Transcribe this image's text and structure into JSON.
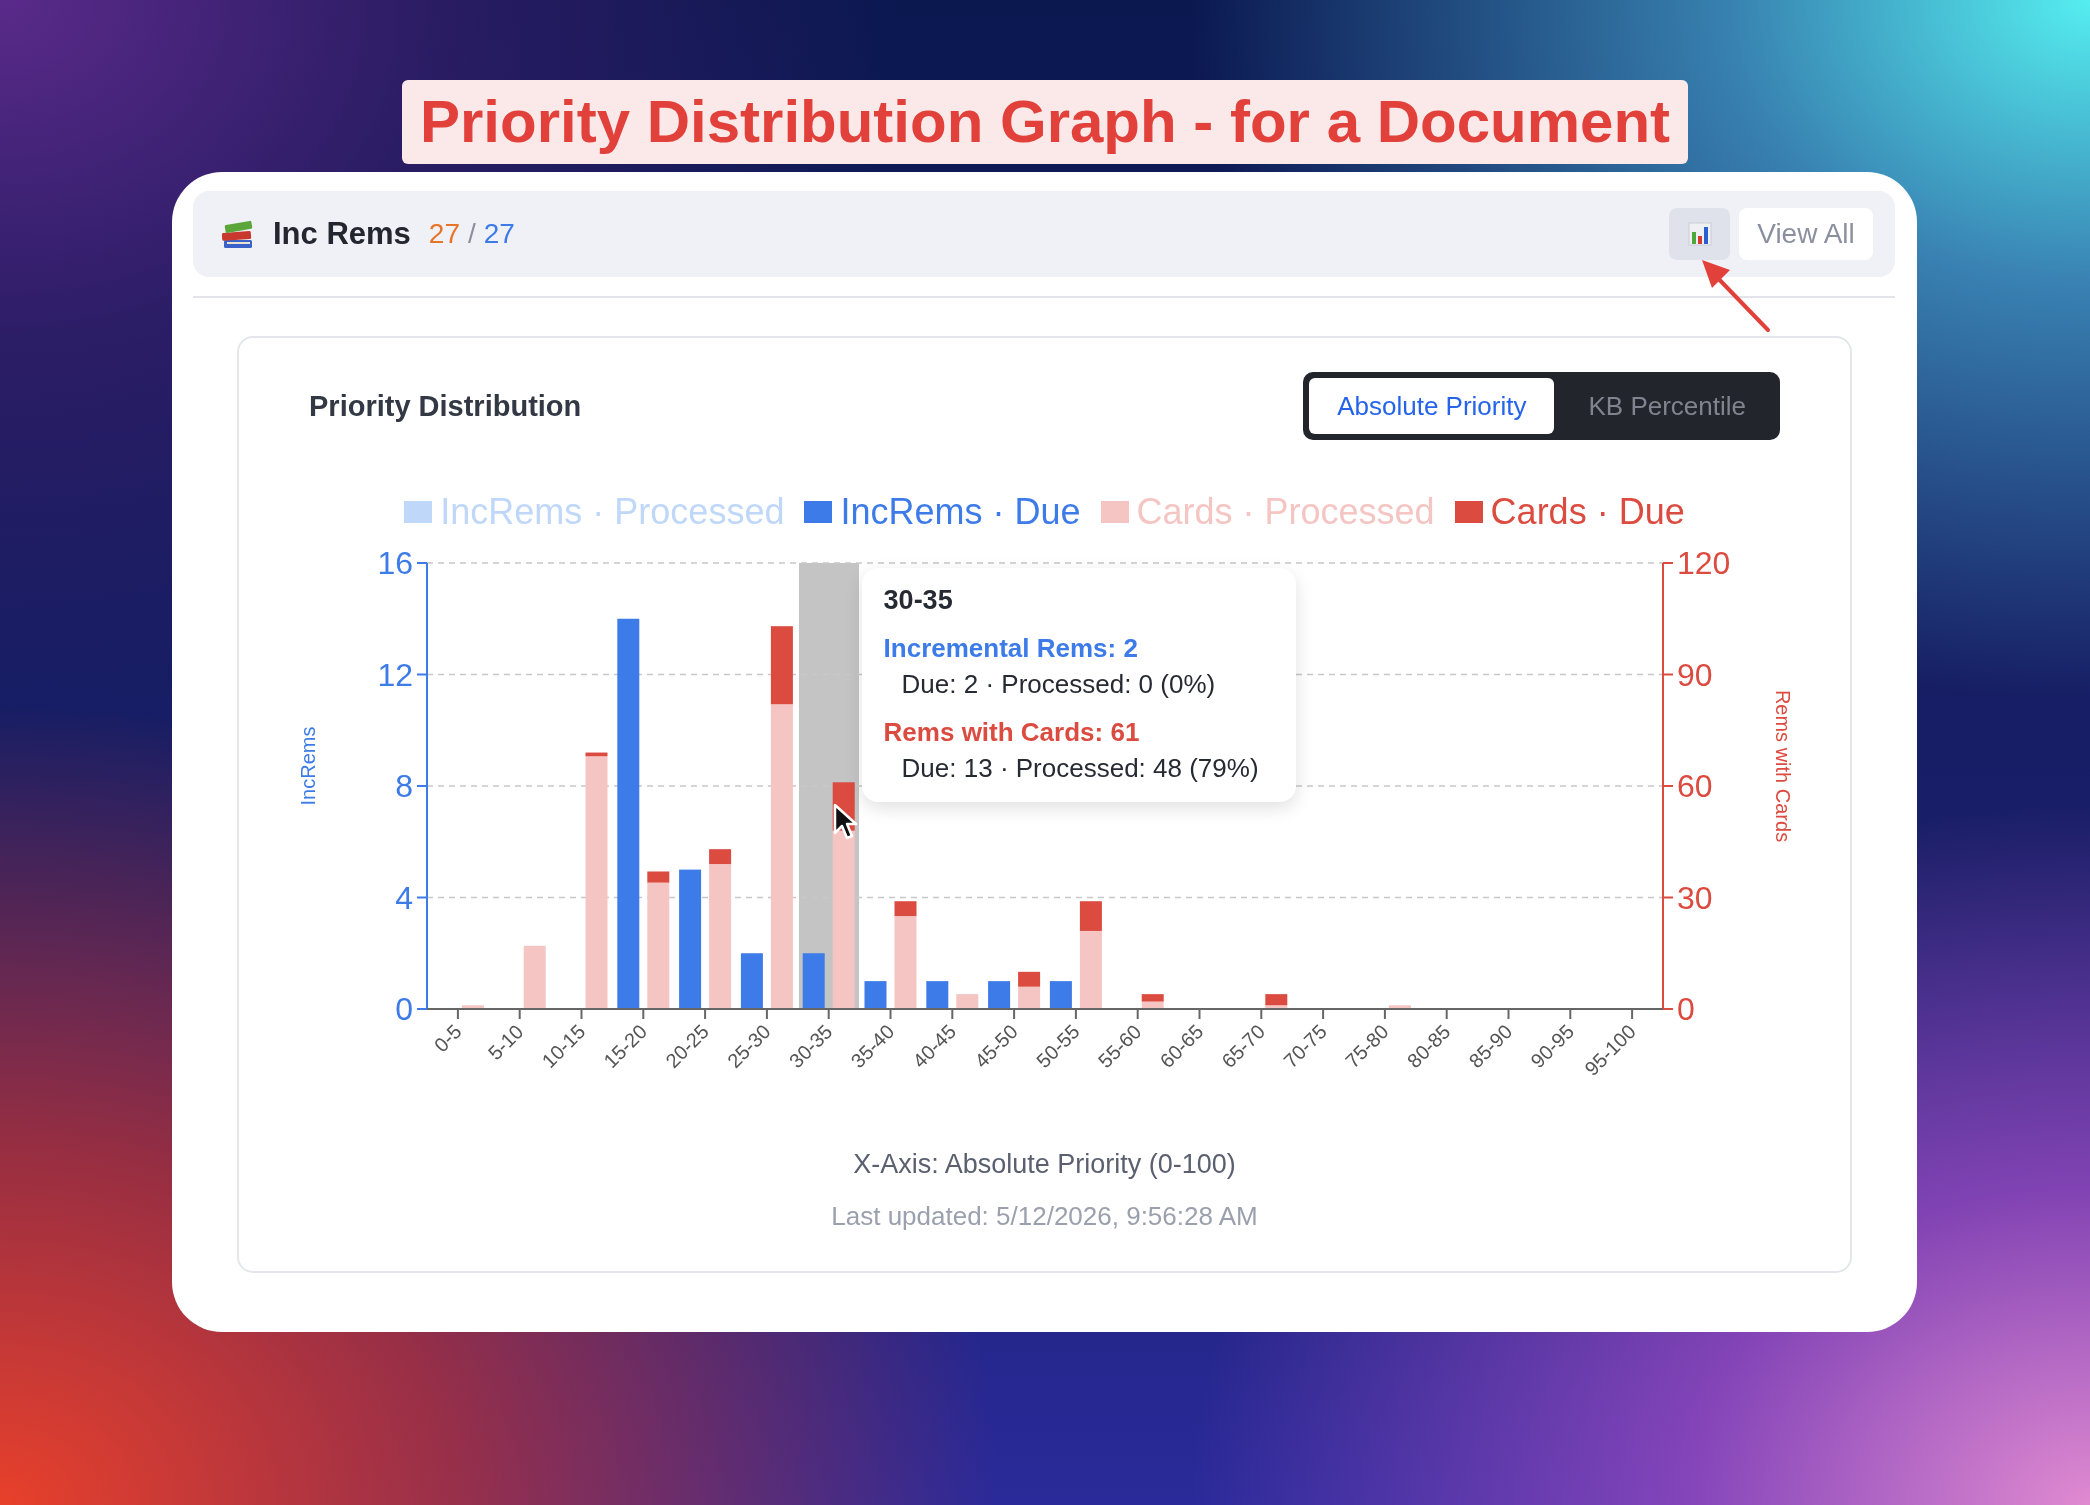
{
  "banner": {
    "title": "Priority Distribution Graph - for a Document"
  },
  "header": {
    "title": "Inc Rems",
    "count_done": "27",
    "separator": "/",
    "count_total": "27",
    "chart_button": {
      "active": true
    },
    "view_all": "View All"
  },
  "panel": {
    "title": "Priority Distribution",
    "modes": [
      {
        "label": "Absolute Priority",
        "selected": true
      },
      {
        "label": "KB Percentile",
        "selected": false
      }
    ],
    "chart_data": {
      "type": "bar",
      "stacked": true,
      "grid": true,
      "legend": true,
      "xlabel": "X-Axis: Absolute Priority (0-100)",
      "ylabel": "IncRems",
      "y2label": "Rems with Cards",
      "ylim": [
        0,
        16
      ],
      "yticks": [
        0,
        4,
        8,
        12,
        16
      ],
      "y2lim": [
        0,
        120
      ],
      "y2ticks": [
        0,
        30,
        60,
        90,
        120
      ],
      "categories": [
        "0-5",
        "5-10",
        "10-15",
        "15-20",
        "20-25",
        "25-30",
        "30-35",
        "35-40",
        "40-45",
        "45-50",
        "50-55",
        "55-60",
        "60-65",
        "65-70",
        "70-75",
        "75-80",
        "80-85",
        "85-90",
        "90-95",
        "95-100"
      ],
      "series": [
        {
          "name": "IncRems · Processed",
          "color": "#bfd7f8",
          "values": [
            0,
            0,
            0,
            0,
            0,
            0,
            0,
            0,
            0,
            0,
            0,
            0,
            0,
            0,
            0,
            0,
            0,
            0,
            0,
            0
          ]
        },
        {
          "name": "IncRems · Due",
          "color": "#3d7be8",
          "values": [
            0,
            0,
            0,
            14,
            5,
            2,
            2,
            1,
            1,
            1,
            1,
            0,
            0,
            0,
            0,
            0,
            0,
            0,
            0,
            0
          ]
        },
        {
          "name": "Cards · Processed",
          "color": "#f5c5c3",
          "axis": "y2",
          "values": [
            1,
            17,
            68,
            34,
            39,
            82,
            48,
            25,
            4,
            6,
            21,
            2,
            0,
            1,
            0,
            1,
            0,
            0,
            0,
            0
          ]
        },
        {
          "name": "Cards · Due",
          "color": "#dc4b40",
          "axis": "y2",
          "values": [
            0,
            0,
            1,
            3,
            4,
            21,
            13,
            4,
            0,
            4,
            8,
            2,
            0,
            3,
            0,
            0,
            0,
            0,
            0,
            0
          ]
        }
      ]
    },
    "tooltip": {
      "title": "30-35",
      "sections": [
        {
          "kind": "increms",
          "heading": "Incremental Rems: 2",
          "detail": "Due: 2 · Processed: 0 (0%)"
        },
        {
          "kind": "cards",
          "heading": "Rems with Cards: 61",
          "detail": "Due: 13 · Processed: 48 (79%)"
        }
      ]
    },
    "last_updated": "Last updated: 5/12/2026, 9:56:28 AM"
  }
}
